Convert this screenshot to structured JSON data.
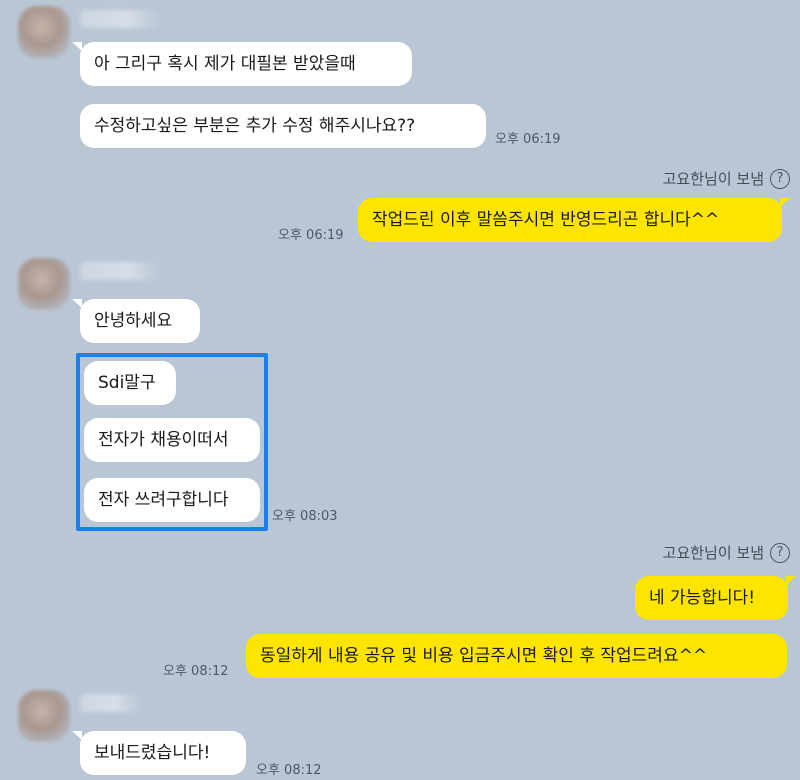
{
  "groups": [
    {
      "messages": [
        {
          "text": "아 그리구 혹시 제가 대필본 받았을때"
        },
        {
          "text": "수정하고싶은 부분은 추가 수정 해주시나요??",
          "time": "오후 06:19"
        }
      ]
    },
    {
      "receipt": "고요한님이 보냄",
      "messages": [
        {
          "text": "작업드린 이후 말씀주시면 반영드리곤 합니다^^",
          "time": "오후 06:19"
        }
      ]
    },
    {
      "messages": [
        {
          "text": "안녕하세요"
        },
        {
          "text": "Sdi말구"
        },
        {
          "text": "전자가 채용이떠서"
        },
        {
          "text": "전자 쓰려구합니다",
          "time": "오후 08:03"
        }
      ]
    },
    {
      "receipt": "고요한님이 보냄",
      "messages": [
        {
          "text": "네 가능합니다!"
        },
        {
          "text": "동일하게 내용 공유 및 비용 입금주시면 확인 후 작업드려요^^",
          "time": "오후 08:12"
        }
      ]
    },
    {
      "messages": [
        {
          "text": "보내드렸습니다!",
          "time": "오후 08:12"
        }
      ]
    }
  ],
  "help_glyph": "?",
  "colors": {
    "background": "#b9c7d5",
    "incoming_bubble": "#ffffff",
    "outgoing_bubble": "#fee500",
    "highlight": "#1a80f0"
  }
}
